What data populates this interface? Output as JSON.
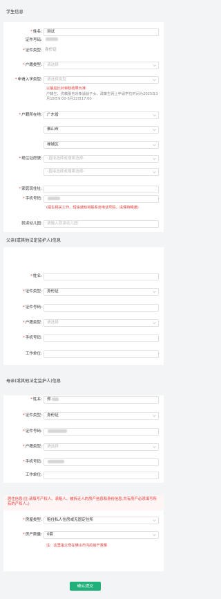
{
  "student": {
    "section_title": "学生信息",
    "name_label": "姓名:",
    "name_value": "测试",
    "id_label": "证件号码:",
    "id_type_label": "证件类型:",
    "id_type_value": "身份证",
    "hukou_type_label": "户籍类型:",
    "hukou_type_placeholder": "请选择",
    "apply_type_label": "申请入学类型:",
    "apply_type_placeholder": "请选择类型",
    "apply_note_red": "以最后比对审核结果为准",
    "apply_note_gray": "户籍生、优教服务对象适龄子女、政策生网上申请学位时间为2025年3月18日9:00-3月22日17:00",
    "hukou_location_label": "户籍所在地:",
    "province_value": "广东省",
    "city_value": "佛山市",
    "district_value": "禅城区",
    "residence_label": "现住址房號:",
    "residence_placeholder_1": "-直接选择或搜索选择-",
    "residence_placeholder_2": "-直接选择或搜索选择-",
    "home_address_label": "家庭现住址:",
    "phone_label": "手机号码:",
    "phone_note": "(招生相关工作、短信通知将联系该电话号码，请保持畅通)",
    "kindergarten_label": "就读幼儿园:",
    "kindergarten_placeholder": "请输入就读幼儿园"
  },
  "father": {
    "section_title": "父亲(或其他法定监护人)信息",
    "name_label": "姓名:",
    "id_type_label": "证件类型:",
    "id_type_value": "身份证",
    "id_label": "证件号码:",
    "hukou_type_label": "户籍类型:",
    "hukou_type_placeholder": "请选择",
    "phone_label": "手机号码:",
    "work_label": "工作单位:"
  },
  "mother": {
    "section_title": "母亲(或其他法定监护人)信息",
    "name_label": "姓名:",
    "name_value": "郑",
    "id_type_label": "证件类型:",
    "id_type_value": "身份证",
    "id_label": "证件号码:",
    "hukou_type_label": "户籍类型:",
    "hukou_type_placeholder": "请选择",
    "phone_label": "手机号码:",
    "work_label": "工作单位:"
  },
  "residence": {
    "note": "居住信息(注:请填写产权人、承租人、被拆迁人的房产信息和身份信息,共有房产必须填写所有的产权人。)",
    "house_type_label": "房屋类型:",
    "house_type_value": "租住私人住房或无固定住所",
    "house_count_label": "房产数量:",
    "house_count_value": "0套",
    "house_count_note": "注：这里指父母在佛山市内的房产数量"
  },
  "submit_label": "确认提交",
  "colors": {
    "accent": "#20b07a",
    "required": "#e53935"
  }
}
